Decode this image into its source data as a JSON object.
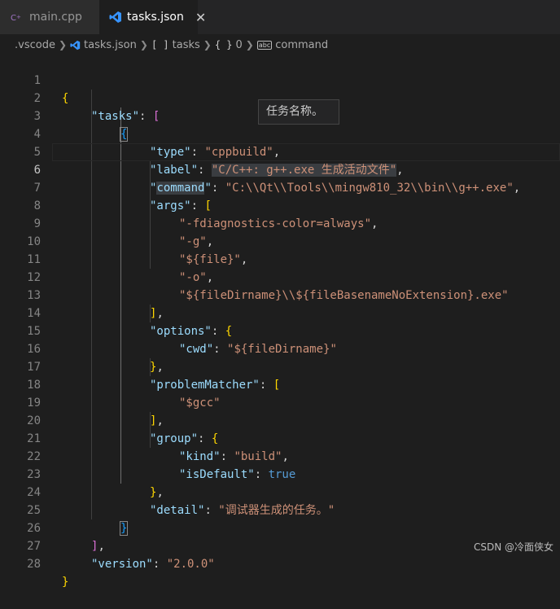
{
  "tabs": [
    {
      "label": "main.cpp",
      "icon": "cpp-file-icon",
      "active": false
    },
    {
      "label": "tasks.json",
      "icon": "vscode-file-icon",
      "active": true,
      "close": "✕"
    }
  ],
  "breadcrumb": {
    "folder": ".vscode",
    "file": "tasks.json",
    "arr_icon": "[ ]",
    "arr_label": "tasks",
    "obj_icon": "{ }",
    "obj_label": "0",
    "abc_icon": "abc",
    "prop_label": "command"
  },
  "code": {
    "line_numbers": [
      "1",
      "2",
      "3",
      "4",
      "5",
      "6",
      "7",
      "8",
      "9",
      "10",
      "11",
      "12",
      "13",
      "14",
      "15",
      "16",
      "17",
      "18",
      "19",
      "20",
      "21",
      "22",
      "23",
      "24",
      "25",
      "26",
      "27",
      "28"
    ],
    "l1_open": "{",
    "l2_key": "\"tasks\"",
    "l2_colon": ": ",
    "l2_open": "[",
    "l3_open": "{",
    "l4_key": "\"type\"",
    "l4_colon": ": ",
    "l4_val": "\"cppbuild\"",
    "l4_comma": ",",
    "l5_key": "\"label\"",
    "l5_colon": ": ",
    "l5_val": "\"C/C++: g++.exe 生成活动文件\"",
    "l5_comma": ",",
    "l6_key_q1": "\"",
    "l6_key_word": "command",
    "l6_key_q2": "\"",
    "l6_colon": ": ",
    "l6_val": "\"C:\\\\Qt\\\\Tools\\\\mingw810_32\\\\bin\\\\g++.exe\"",
    "l6_comma": ",",
    "l7_key": "\"args\"",
    "l7_colon": ": ",
    "l7_open": "[",
    "l8_val": "\"-fdiagnostics-color=always\"",
    "l8_comma": ",",
    "l9_val": "\"-g\"",
    "l9_comma": ",",
    "l10_val": "\"${file}\"",
    "l10_comma": ",",
    "l11_val": "\"-o\"",
    "l11_comma": ",",
    "l12_val": "\"${fileDirname}\\\\${fileBasenameNoExtension}.exe\"",
    "l13_close": "]",
    "l13_comma": ",",
    "l14_key": "\"options\"",
    "l14_colon": ": ",
    "l14_open": "{",
    "l15_key": "\"cwd\"",
    "l15_colon": ": ",
    "l15_val": "\"${fileDirname}\"",
    "l16_close": "}",
    "l16_comma": ",",
    "l17_key": "\"problemMatcher\"",
    "l17_colon": ": ",
    "l17_open": "[",
    "l18_val": "\"$gcc\"",
    "l19_close": "]",
    "l19_comma": ",",
    "l20_key": "\"group\"",
    "l20_colon": ": ",
    "l20_open": "{",
    "l21_key": "\"kind\"",
    "l21_colon": ": ",
    "l21_val": "\"build\"",
    "l21_comma": ",",
    "l22_key": "\"isDefault\"",
    "l22_colon": ": ",
    "l22_val": "true",
    "l23_close": "}",
    "l23_comma": ",",
    "l24_key": "\"detail\"",
    "l24_colon": ": ",
    "l24_val": "\"调试器生成的任务。\"",
    "l25_close": "}",
    "l26_close": "]",
    "l26_comma": ",",
    "l27_key": "\"version\"",
    "l27_colon": ": ",
    "l27_val": "\"2.0.0\"",
    "l28_close": "}"
  },
  "tooltip": "任务名称。",
  "watermark": "CSDN @冷面侠女",
  "colors": {
    "background": "#1e1e1e",
    "key": "#9cdcfe",
    "string": "#ce9178",
    "keyword": "#569cd6",
    "bracket_level1": "#ffd700",
    "bracket_level2": "#da70d6",
    "bracket_level3": "#179fff"
  }
}
